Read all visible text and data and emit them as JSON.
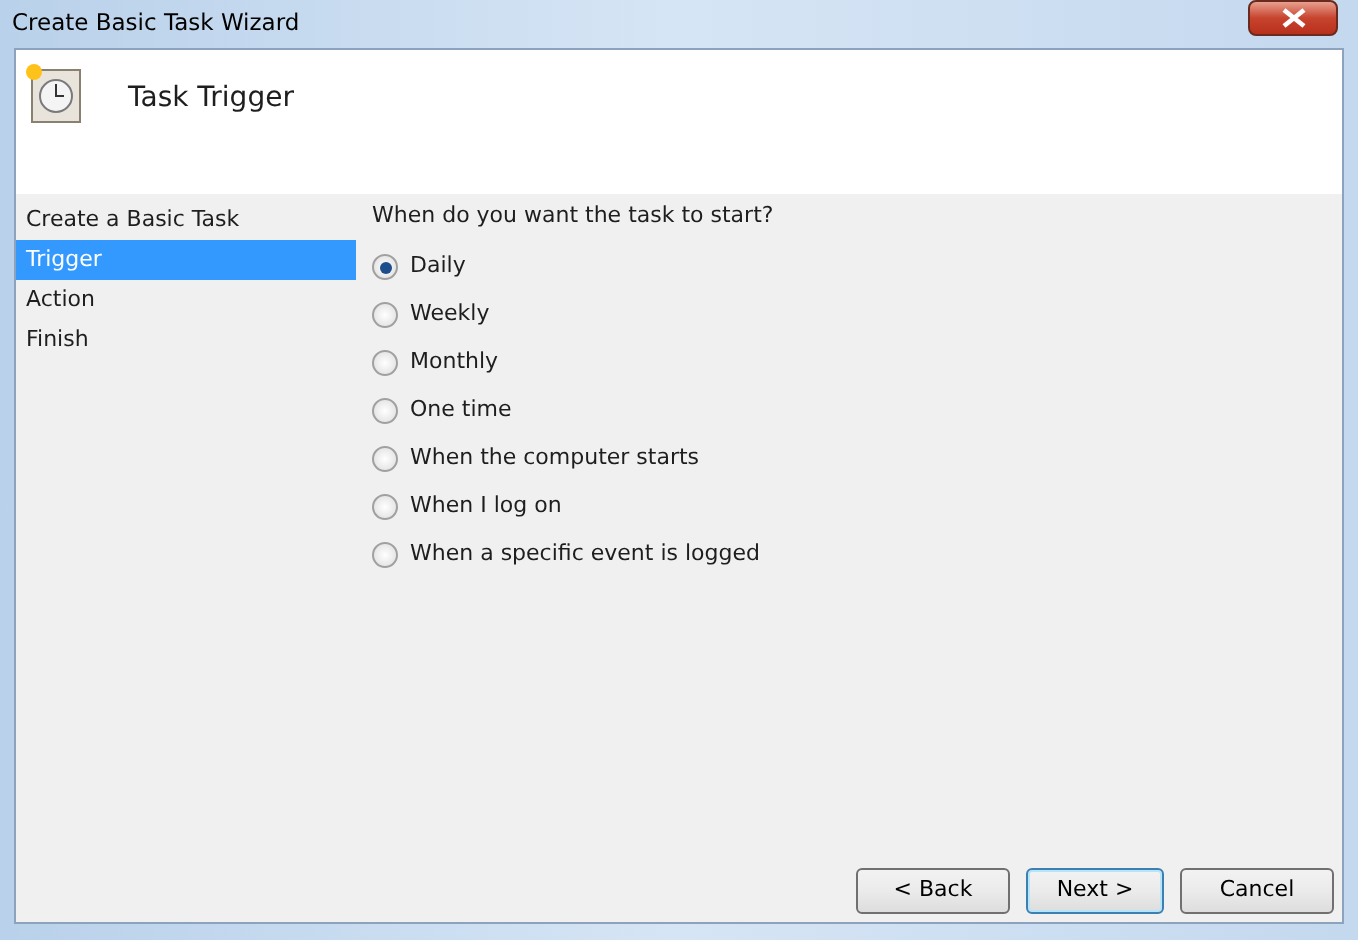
{
  "window": {
    "title": "Create Basic Task Wizard"
  },
  "header": {
    "title": "Task Trigger"
  },
  "sidebar": {
    "items": [
      {
        "label": "Create a Basic Task",
        "selected": false
      },
      {
        "label": "Trigger",
        "selected": true
      },
      {
        "label": "Action",
        "selected": false
      },
      {
        "label": "Finish",
        "selected": false
      }
    ]
  },
  "question": "When do you want the task to start?",
  "options": [
    {
      "label": "Daily",
      "selected": true
    },
    {
      "label": "Weekly",
      "selected": false
    },
    {
      "label": "Monthly",
      "selected": false
    },
    {
      "label": "One time",
      "selected": false
    },
    {
      "label": "When the computer starts",
      "selected": false
    },
    {
      "label": "When I log on",
      "selected": false
    },
    {
      "label": "When a specific event is logged",
      "selected": false
    }
  ],
  "buttons": [
    {
      "label": "< Back",
      "kind": "normal"
    },
    {
      "label": "Next >",
      "kind": "default"
    },
    {
      "label": "Cancel",
      "kind": "normal"
    }
  ]
}
